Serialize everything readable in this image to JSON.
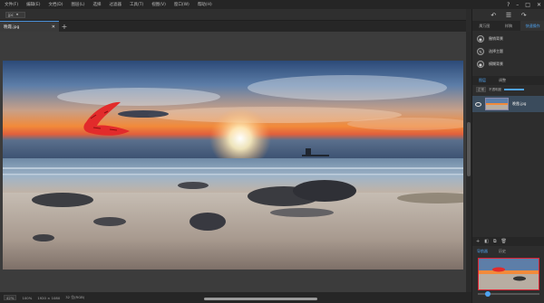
{
  "menu": [
    "文件(F)",
    "编辑(E)",
    "文档(D)",
    "图层(L)",
    "选择",
    "过滤器",
    "工具(T)",
    "视图(V)",
    "窗口(W)",
    "帮助(H)"
  ],
  "options": {
    "tool_select": "jpc"
  },
  "tab": {
    "name": "晚霞.jpg"
  },
  "panel_tabs": [
    "属万图",
    "样稿",
    "快速操作"
  ],
  "actions": [
    {
      "icon": "circle-icon",
      "label": "撤销背景"
    },
    {
      "icon": "brush-icon",
      "label": "选择主题"
    },
    {
      "icon": "drop-icon",
      "label": "模糊背景"
    }
  ],
  "layers": {
    "tabs": [
      "图层",
      "调整"
    ],
    "blend": "正常",
    "opacity_label": "不透明度",
    "items": [
      {
        "name": "晚霞.jpg",
        "visible": true
      }
    ]
  },
  "navigator": {
    "tabs": [
      "导航器",
      "历史"
    ],
    "zoom": 0.12
  },
  "status": {
    "zoom": "42%",
    "zoom2": "100%",
    "doc": "1920 × 1080",
    "bits": "32 位(RGB)"
  },
  "colors": {
    "accent": "#4fa3f0",
    "markup": "#e22b2b"
  }
}
